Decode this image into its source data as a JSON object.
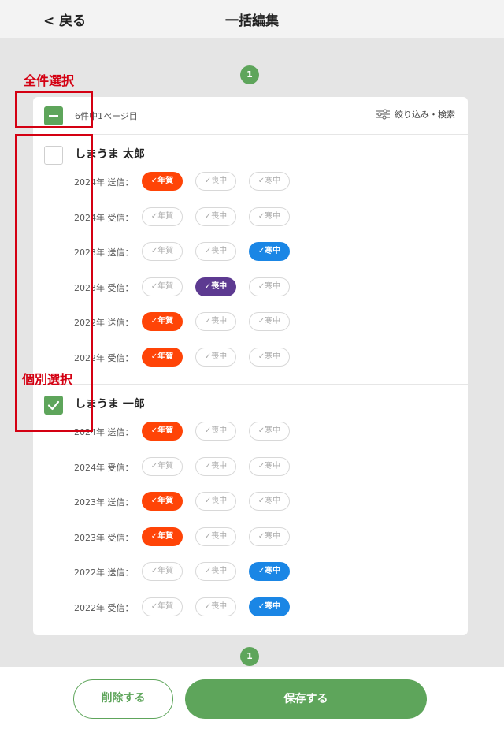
{
  "header": {
    "back_label": "< 戻る",
    "title": "一括編集"
  },
  "pagination": {
    "current_page": "1"
  },
  "list_header": {
    "count_text": "6件中1ページ目",
    "filter_label": "絞り込み・検索",
    "filter_icon": "sliders-icon",
    "select_all_state": "indeterminate"
  },
  "annotations": {
    "select_all": "全件選択",
    "individual": "個別選択"
  },
  "chip_labels": {
    "nenga": "年賀",
    "mochu": "喪中",
    "kanchu": "寒中"
  },
  "chip_colors": {
    "nenga": "#ff4407",
    "mochu": "#5d3a91",
    "kanchu": "#1a86e5"
  },
  "people": [
    {
      "name": "しまうま 太郎",
      "checked": false,
      "records": [
        {
          "label": "2024年 送信：",
          "active": "nenga"
        },
        {
          "label": "2024年 受信：",
          "active": ""
        },
        {
          "label": "2023年 送信：",
          "active": "kanchu"
        },
        {
          "label": "2023年 受信：",
          "active": "mochu"
        },
        {
          "label": "2022年 送信：",
          "active": "nenga"
        },
        {
          "label": "2022年 受信：",
          "active": "nenga"
        }
      ]
    },
    {
      "name": "しまうま 一郎",
      "checked": true,
      "records": [
        {
          "label": "2024年 送信：",
          "active": "nenga"
        },
        {
          "label": "2024年 受信：",
          "active": ""
        },
        {
          "label": "2023年 送信：",
          "active": "nenga"
        },
        {
          "label": "2023年 受信：",
          "active": "nenga"
        },
        {
          "label": "2022年 送信：",
          "active": "kanchu"
        },
        {
          "label": "2022年 受信：",
          "active": "kanchu"
        }
      ]
    }
  ],
  "footer": {
    "delete_label": "削除する",
    "save_label": "保存する"
  },
  "colors": {
    "accent": "#5ea55b",
    "annotation": "#d40012"
  }
}
